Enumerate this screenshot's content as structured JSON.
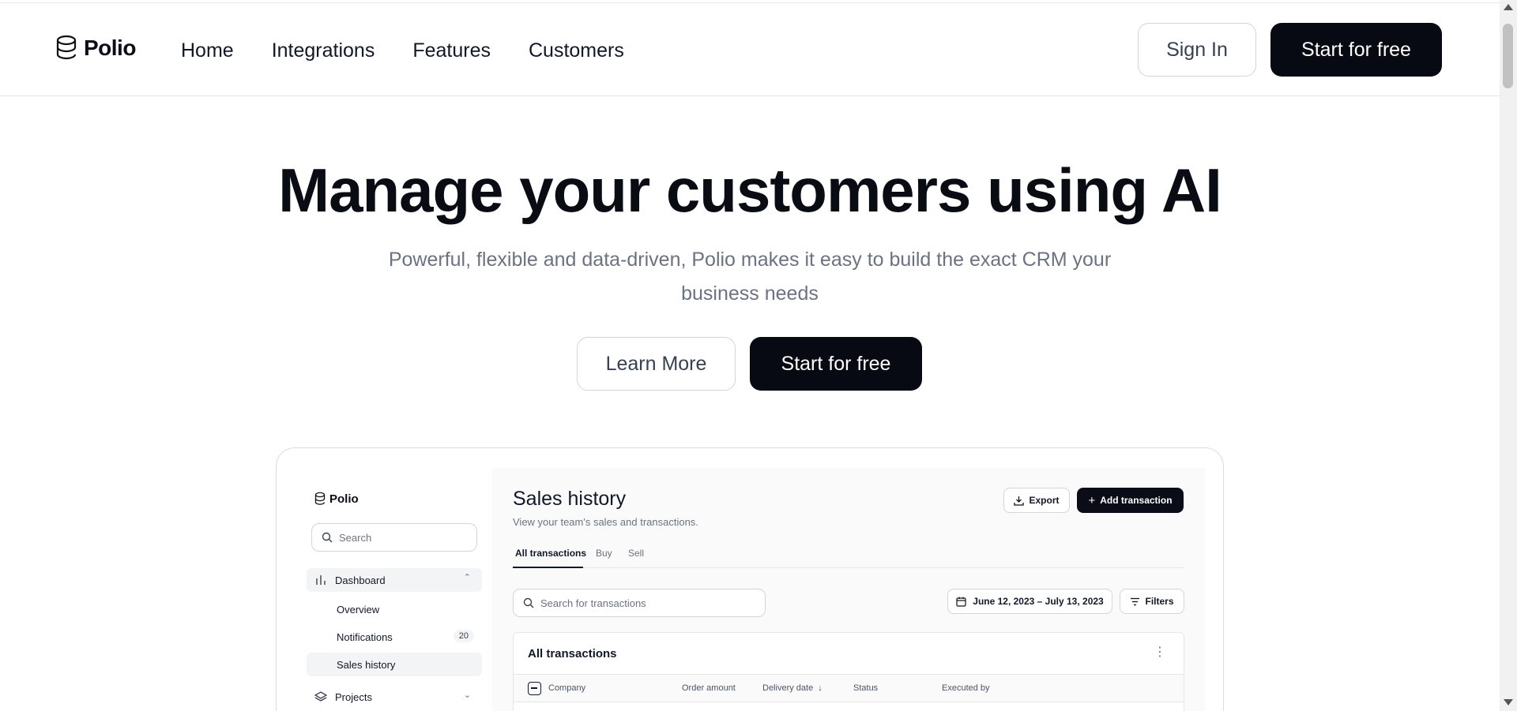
{
  "nav": {
    "logo_text": "Polio",
    "links": [
      "Home",
      "Integrations",
      "Features",
      "Customers"
    ],
    "sign_in": "Sign In",
    "cta": "Start for free"
  },
  "hero": {
    "title": "Manage your customers using AI",
    "subtitle": "Powerful, flexible and data-driven, Polio makes it easy to build the exact CRM your business needs",
    "learn_more": "Learn More",
    "cta": "Start for free"
  },
  "mock": {
    "logo_text": "Polio",
    "search_placeholder": "Search",
    "sidebar": [
      {
        "label": "Dashboard",
        "icon": "bar-chart-icon"
      },
      {
        "label": "Overview"
      },
      {
        "label": "Notifications",
        "badge": "20"
      },
      {
        "label": "Sales history",
        "active": true
      },
      {
        "label": "Projects",
        "icon": "layers-icon"
      }
    ],
    "title": "Sales history",
    "subtitle": "View your team's sales and transactions.",
    "export": "Export",
    "add": "Add transaction",
    "tabs": [
      "All transactions",
      "Buy",
      "Sell"
    ],
    "tx_search": "Search for transactions",
    "date_range": "June 12, 2023 – July 13, 2023",
    "filters": "Filters",
    "card_title": "All transactions",
    "columns": [
      "Company",
      "Order amount",
      "Delivery date",
      "Status",
      "Executed by"
    ]
  }
}
